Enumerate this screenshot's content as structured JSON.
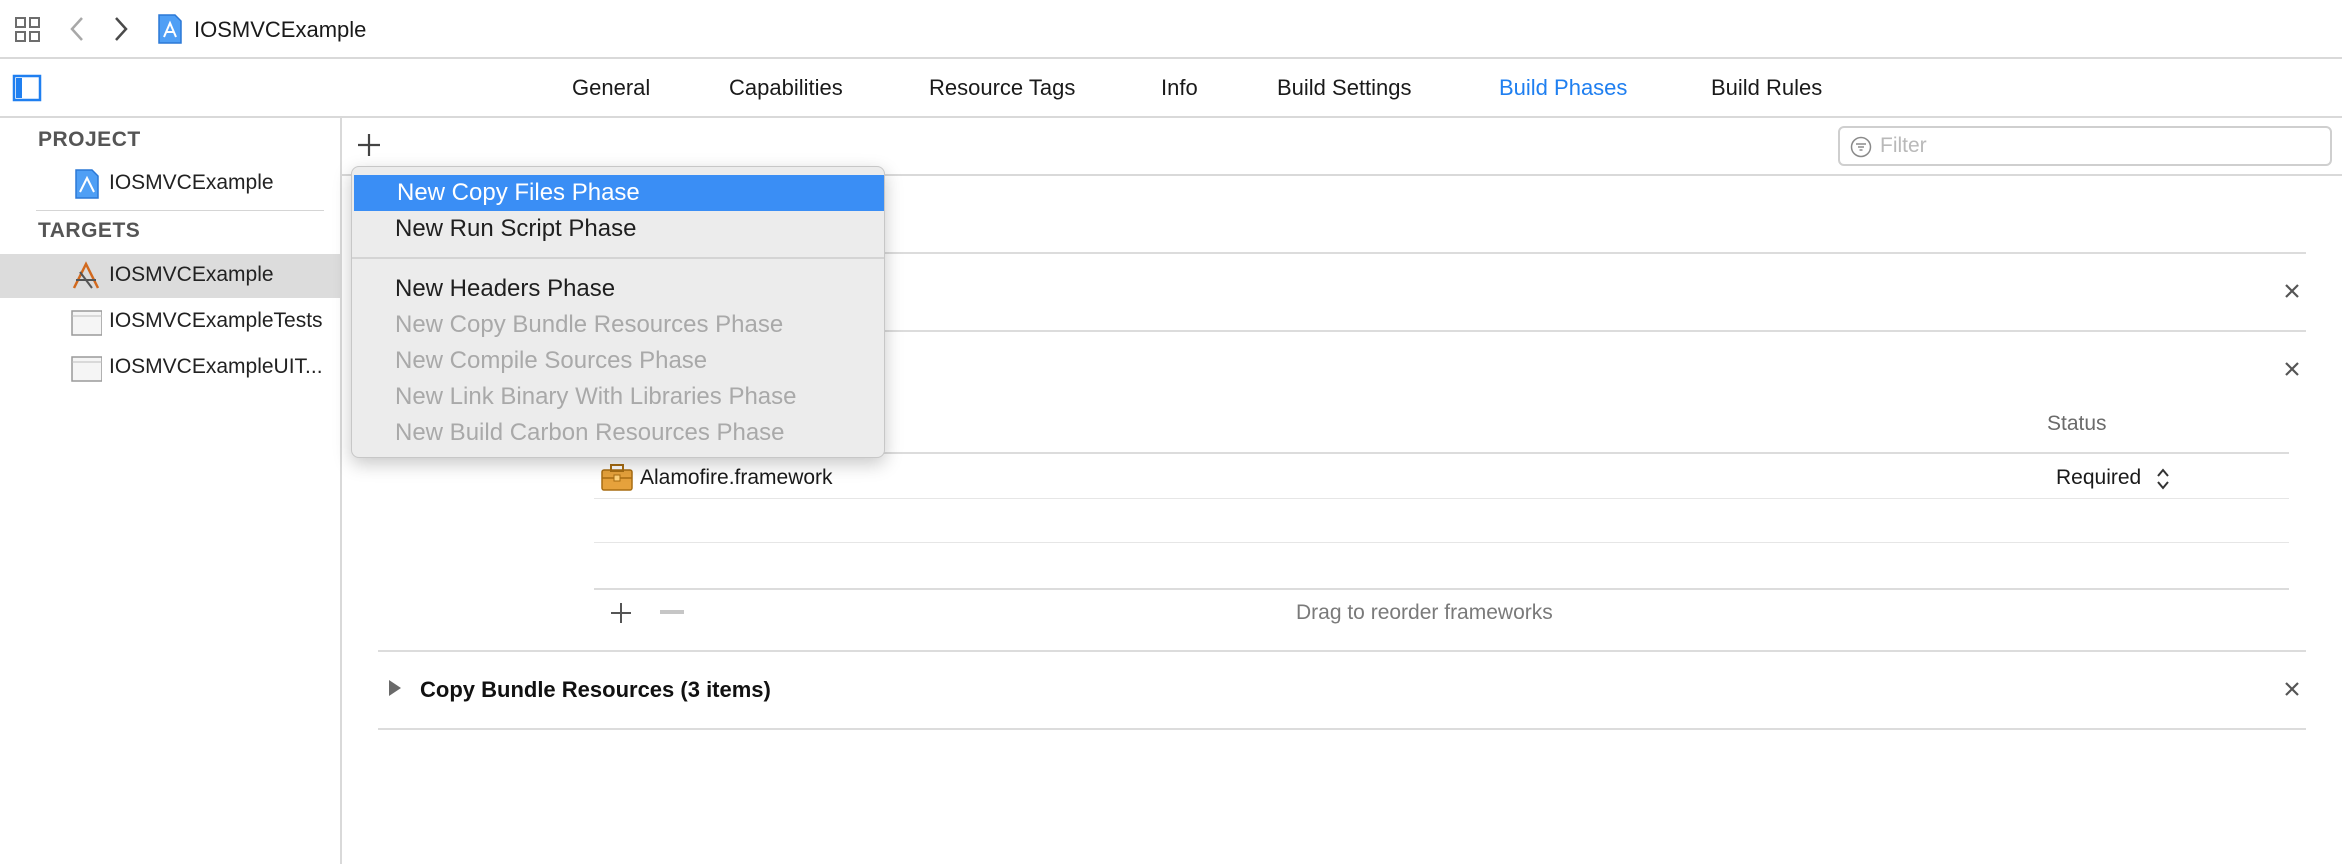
{
  "jumpbar": {
    "project_name": "IOSMVCExample"
  },
  "tabs": [
    {
      "label": "General",
      "active": false
    },
    {
      "label": "Capabilities",
      "active": false
    },
    {
      "label": "Resource Tags",
      "active": false
    },
    {
      "label": "Info",
      "active": false
    },
    {
      "label": "Build Settings",
      "active": false
    },
    {
      "label": "Build Phases",
      "active": true
    },
    {
      "label": "Build Rules",
      "active": false
    }
  ],
  "sidebar": {
    "project_section": "PROJECT",
    "project_item": "IOSMVCExample",
    "targets_section": "TARGETS",
    "targets": [
      {
        "label": "IOSMVCExample",
        "selected": true
      },
      {
        "label": "IOSMVCExampleTests",
        "selected": false
      },
      {
        "label": "IOSMVCExampleUIT...",
        "selected": false
      }
    ]
  },
  "toolbar": {
    "filter_placeholder": "Filter"
  },
  "menu": {
    "items": [
      {
        "label": "New Copy Files Phase",
        "state": "highlighted"
      },
      {
        "label": "New Run Script Phase",
        "state": "enabled"
      },
      {
        "label": "New Headers Phase",
        "state": "enabled"
      },
      {
        "label": "New Copy Bundle Resources Phase",
        "state": "disabled"
      },
      {
        "label": "New Compile Sources Phase",
        "state": "disabled"
      },
      {
        "label": "New Link Binary With Libraries Phase",
        "state": "disabled"
      },
      {
        "label": "New Build Carbon Resources Phase",
        "state": "disabled"
      }
    ]
  },
  "link_phase": {
    "status_header": "Status",
    "library": {
      "name": "Alamofire.framework",
      "status": "Required"
    },
    "drag_hint": "Drag to reorder frameworks"
  },
  "copy_bundle_phase": {
    "title": "Copy Bundle Resources (3 items)"
  },
  "colors": {
    "accent": "#1f7ff0",
    "menu_highlight": "#3a8ef5",
    "selection": "#dcdcdc"
  }
}
